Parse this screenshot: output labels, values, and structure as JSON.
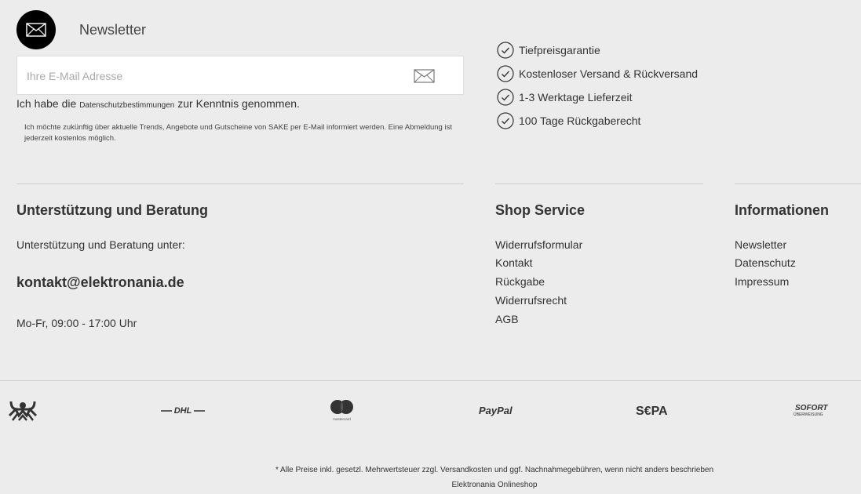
{
  "newsletter": {
    "title": "Newsletter",
    "email_placeholder": "Ihre E-Mail Adresse",
    "privacy_prefix": "Ich habe die",
    "privacy_link": "Datenschutzbestimmungen",
    "privacy_suffix": "zur Kenntnis genommen.",
    "note": "Ich möchte zukünftig über aktuelle Trends, Angebote und Gutscheine von SAKE per E-Mail informiert werden. Eine Abmeldung ist jederzeit kostenlos möglich."
  },
  "benefits": [
    "Tiefpreisgarantie",
    "Kostenloser Versand & Rückversand",
    "1-3 Werktage Lieferzeit",
    "100 Tage Rückgaberecht"
  ],
  "support": {
    "title": "Unterstützung und Beratung",
    "intro": "Unterstützung und Beratung unter:",
    "email": "kontakt@elektronania.de",
    "hours": "Mo-Fr, 09:00 - 17:00 Uhr"
  },
  "shop_service": {
    "title": "Shop Service",
    "links": [
      "Widerrufsformular",
      "Kontakt",
      "Rückgabe",
      "Widerrufsrecht",
      "AGB"
    ]
  },
  "information": {
    "title": "Informationen",
    "links": [
      "Newsletter",
      "Datenschutz",
      "Impressum"
    ]
  },
  "logos": {
    "dhl": "DHL",
    "mastercard": "mastercard",
    "paypal": "PayPal",
    "sepa": "S€PA",
    "sofort": "SOFORT",
    "sofort_sub": "ÜBERWEISUNG"
  },
  "footer": {
    "disclaimer": "* Alle Preise inkl. gesetzl. Mehrwertsteuer zzgl. Versandkosten und ggf. Nachnahmegebühren, wenn nicht anders beschrieben",
    "shop_name": "Elektronania Onlineshop"
  },
  "colors": {
    "background": "#ececec",
    "text": "#333333",
    "divider": "#d0d0d0"
  }
}
